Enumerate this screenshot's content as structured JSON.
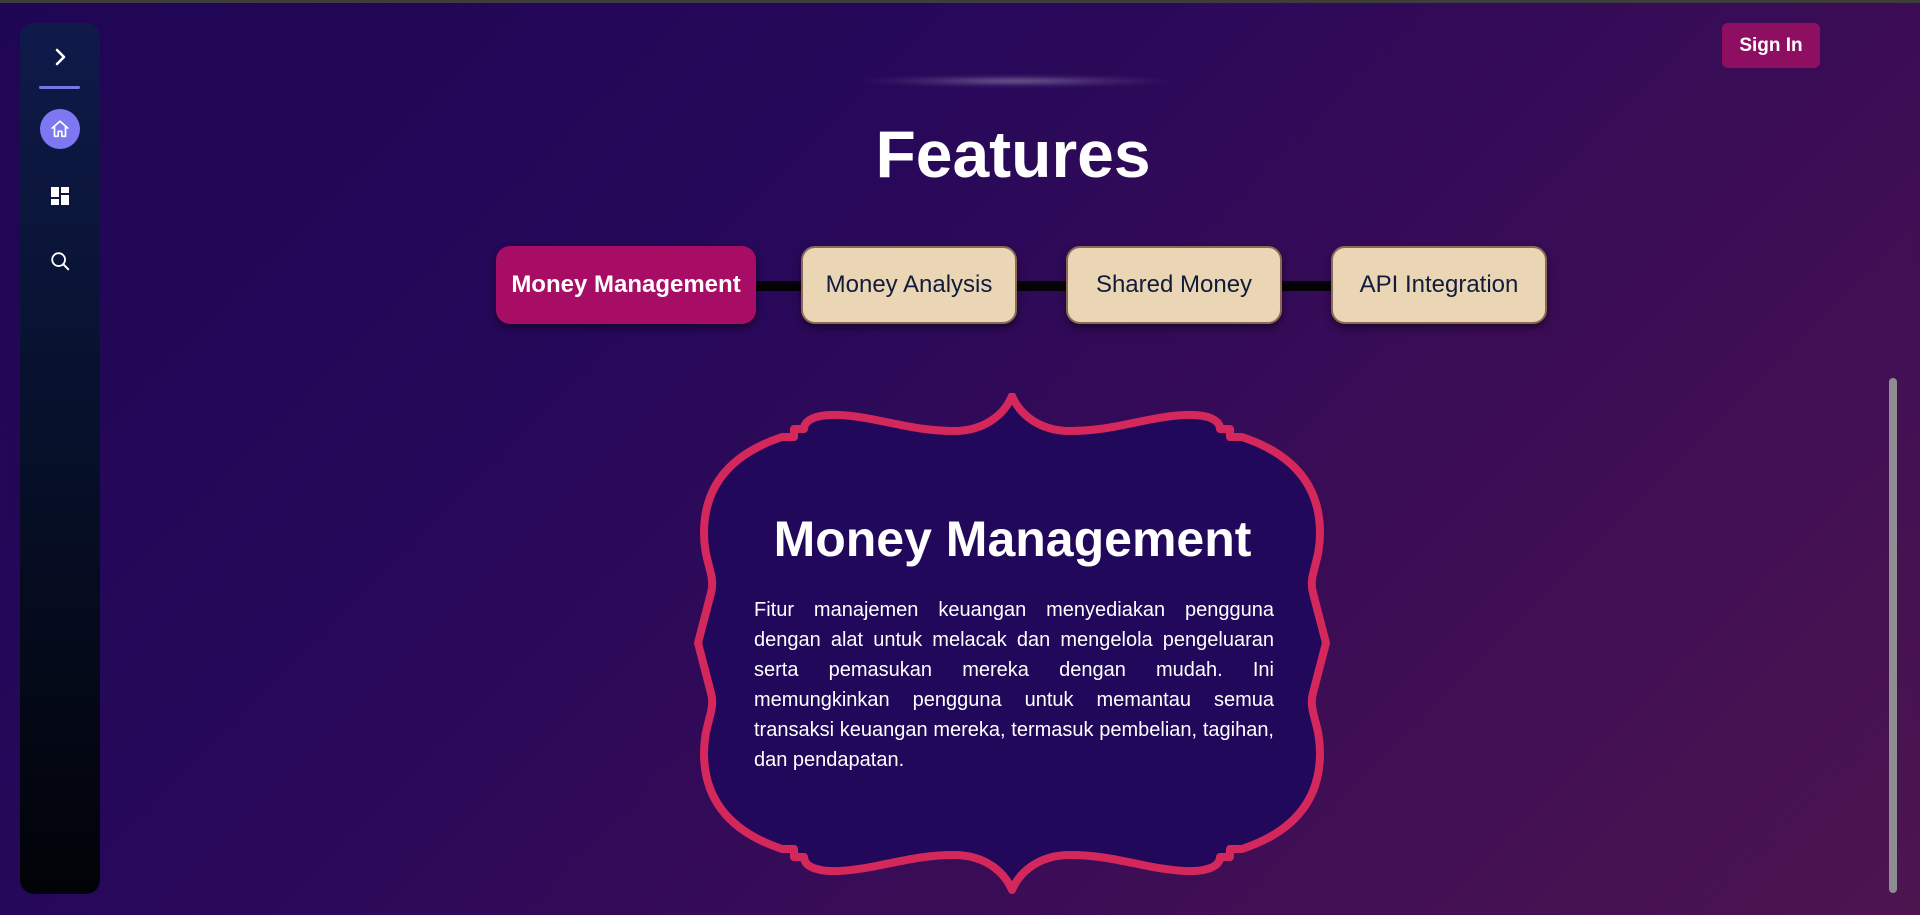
{
  "header": {
    "sign_in_label": "Sign In"
  },
  "sidebar": {
    "items": [
      {
        "name": "home",
        "icon": "home-icon",
        "active": true
      },
      {
        "name": "dashboard",
        "icon": "dashboard-icon",
        "active": false
      },
      {
        "name": "search",
        "icon": "search-icon",
        "active": false
      }
    ]
  },
  "main": {
    "title": "Features",
    "tabs": [
      {
        "label": "Money Management",
        "active": true
      },
      {
        "label": "Money Analysis",
        "active": false
      },
      {
        "label": "Shared Money",
        "active": false
      },
      {
        "label": "API Integration",
        "active": false
      }
    ],
    "card": {
      "title": "Money Management",
      "description": "Fitur manajemen keuangan menyediakan pengguna dengan alat untuk melacak dan mengelola pengeluaran serta pemasukan mereka dengan mudah. Ini memungkinkan pengguna untuk memantau semua transaksi keuangan mereka, termasuk pembelian, tagihan, dan pendapatan."
    }
  },
  "colors": {
    "active_tab": "#a70d65",
    "inactive_tab": "#ead5b5",
    "card_border": "#d4285c",
    "sign_in": "#8e0f62",
    "sidebar_active": "#7d78f2"
  }
}
